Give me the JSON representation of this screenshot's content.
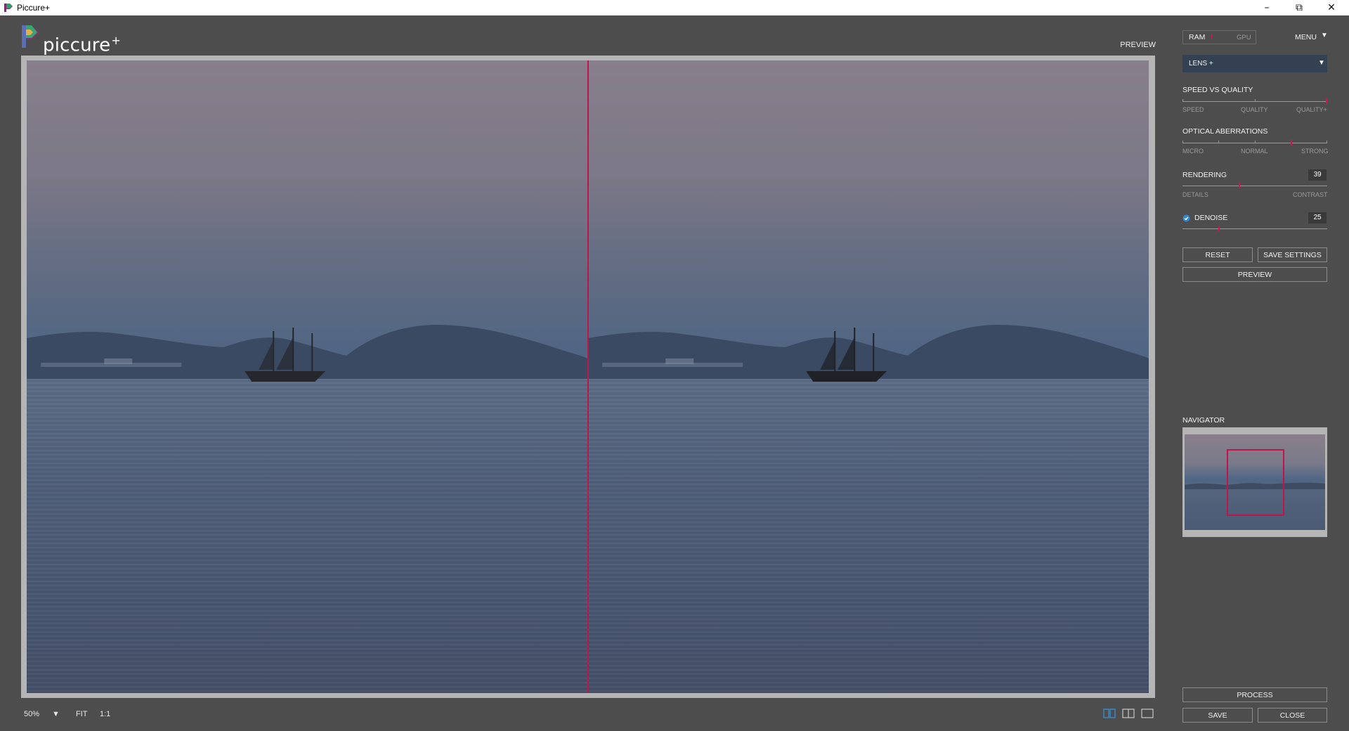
{
  "window": {
    "title": "Piccure+",
    "controls": {
      "minimize": "–",
      "restore": "⧉",
      "close": "✕"
    }
  },
  "logo": {
    "text": "piccure",
    "plus": "+"
  },
  "preview_label": "PREVIEW",
  "bottombar": {
    "zoom": "50%",
    "zoom_arrow": "▼",
    "fit": "FIT",
    "one_to_one": "1:1"
  },
  "panel": {
    "ram": "RAM",
    "gpu": "GPU",
    "ram_indicator": "!",
    "menu": "MENU",
    "menu_arrow": "▼",
    "mode": "LENS +",
    "mode_arrow": "▼",
    "speed_vs_quality": {
      "label": "SPEED VS QUALITY",
      "ticks": [
        "SPEED",
        "QUALITY",
        "QUALITY+"
      ],
      "value_fraction": 1.0
    },
    "optical_aberrations": {
      "label": "OPTICAL ABERRATIONS",
      "ticks": [
        "MICRO",
        "NORMAL",
        "STRONG"
      ],
      "value_fraction": 0.75
    },
    "rendering": {
      "label": "RENDERING",
      "value": "39",
      "value_fraction": 0.39,
      "left": "DETAILS",
      "right": "CONTRAST"
    },
    "denoise": {
      "label": "DENOISE",
      "value": "25",
      "value_fraction": 0.25,
      "checked": true
    },
    "reset": "RESET",
    "save_settings": "SAVE SETTINGS",
    "preview": "PREVIEW",
    "navigator": "NAVIGATOR",
    "process": "PROCESS",
    "save": "SAVE",
    "close": "CLOSE"
  },
  "colors": {
    "accent": "#c0144c",
    "background": "#4d4d4d",
    "dropdown": "#334152"
  }
}
